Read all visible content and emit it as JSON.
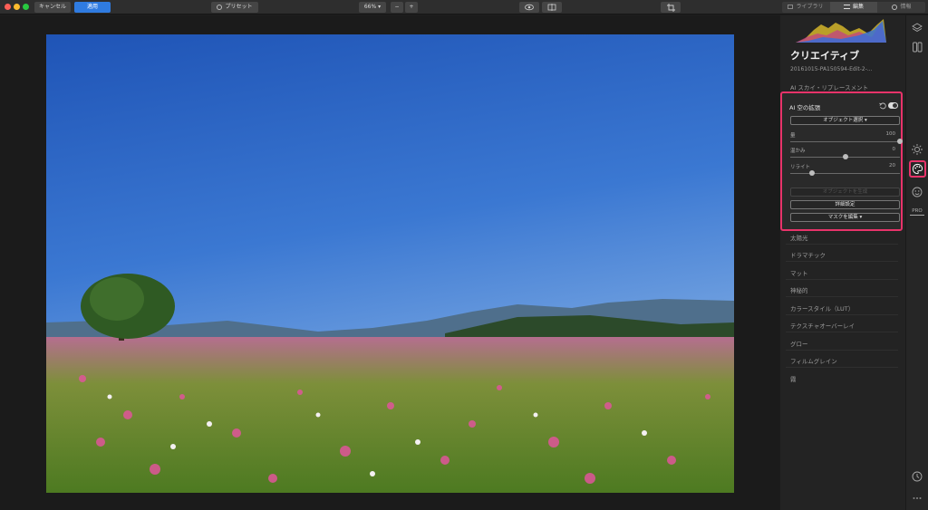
{
  "toolbar": {
    "cancel_label": "キャンセル",
    "apply_label": "適用",
    "preset_label": "プリセット",
    "zoom_value": "66%",
    "zoom_out": "−",
    "zoom_in": "+"
  },
  "tabs": {
    "library": "ライブラリ",
    "edit": "編集",
    "info": "情報",
    "active": "edit"
  },
  "panel": {
    "title": "クリエイティブ",
    "filename": "20161015-PA150594-Edit-2-...",
    "ai_sky_replacement": "AI スカイ・リプレースメント",
    "tool": {
      "title": "AI 空の拡張",
      "object_select": "オブジェクト選択 ▾",
      "sliders": [
        {
          "label": "量",
          "value": "100",
          "fraction": 1.0
        },
        {
          "label": "温かみ",
          "value": "0",
          "fraction": 0.5
        },
        {
          "label": "リライト",
          "value": "20",
          "fraction": 0.2
        }
      ],
      "disabled_button": "オブジェクトを生成",
      "detail_button": "詳細設定",
      "mask_button": "マスクを編集 ▾"
    },
    "categories": [
      "太陽光",
      "ドラマチック",
      "マット",
      "神秘的",
      "カラースタイル（LUT）",
      "テクスチャオーバーレイ",
      "グロー",
      "フィルムグレイン",
      "霧"
    ]
  },
  "colors": {
    "accent": "#2f7be0",
    "highlight": "#e8336a",
    "panel_bg": "#232323"
  },
  "rail_icons": [
    "layers-icon",
    "compare-icon",
    "sun-icon",
    "palette-icon",
    "face-icon",
    "pro-badge",
    "history-icon",
    "more-icon"
  ],
  "rail_pro": "PRO"
}
